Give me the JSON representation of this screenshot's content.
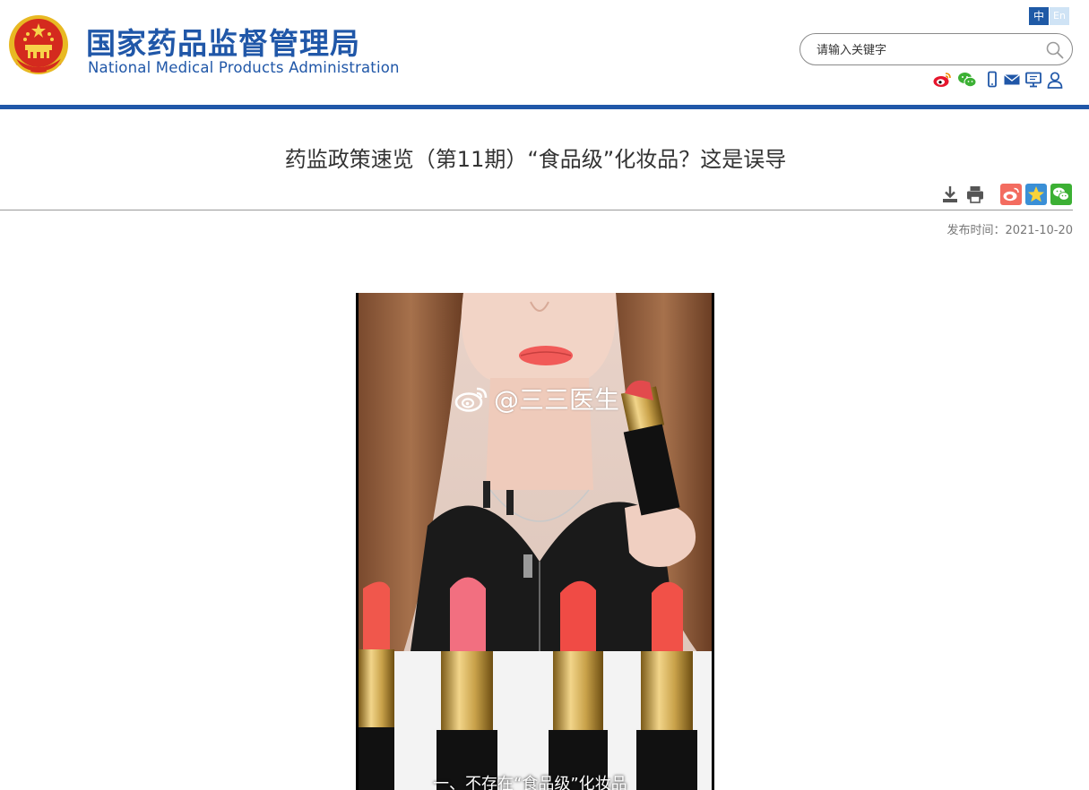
{
  "header": {
    "site_title_cn": "国家药品监督管理局",
    "site_title_en": "National Medical Products Administration",
    "lang_zh": "中",
    "lang_en": "En",
    "search_placeholder": "请输入关键字",
    "brand_color": "#2057a8",
    "social_icons": [
      "weibo-icon",
      "wechat-icon",
      "mobile-icon",
      "mail-icon",
      "display-icon",
      "user-icon"
    ]
  },
  "article": {
    "title": "药监政策速览（第11期）“食品级”化妆品？这是误导",
    "publish_time": "发布时间：2021-10-20",
    "tools": [
      "download-icon",
      "print-icon",
      "share-weibo-icon",
      "share-qzone-icon",
      "share-wechat-icon"
    ],
    "video": {
      "watermark": "@三三医生",
      "subtitle": "一、不存在“食品级”化妆品"
    }
  },
  "colors": {
    "weibo": "#e6162d",
    "wechat": "#3cb034",
    "nav_icon_blue": "#2057a8",
    "share_weibo_bg": "#f36c60",
    "share_qzone_bg": "#3a8fd6",
    "share_wechat_bg": "#3cb034"
  }
}
